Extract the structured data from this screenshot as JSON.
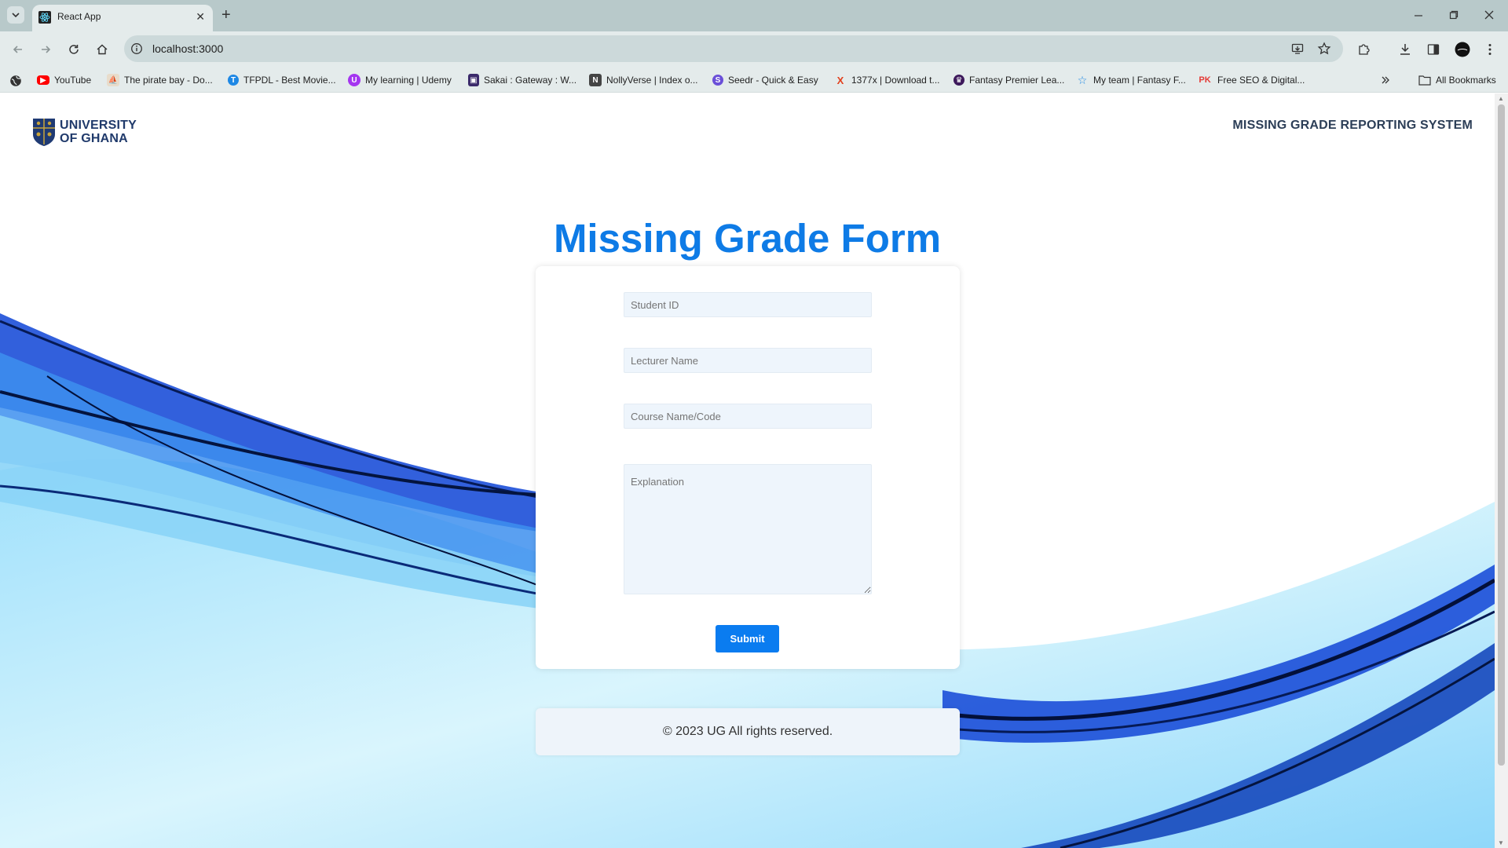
{
  "browser": {
    "tab_title": "React App",
    "tab_close_label": "✕",
    "url": "localhost:3000",
    "bookmarks": [
      {
        "label": "YouTube",
        "icon": "youtube-icon",
        "color": "#ff0000"
      },
      {
        "label": "The pirate bay - Do...",
        "icon": "pirate-ship-icon",
        "color": "#c79a64"
      },
      {
        "label": "TFPDL - Best Movie...",
        "icon": "tfpdl-icon",
        "color": "#1e88e5"
      },
      {
        "label": "My learning | Udemy",
        "icon": "udemy-icon",
        "color": "#a435f0"
      },
      {
        "label": "Sakai : Gateway : W...",
        "icon": "sakai-icon",
        "color": "#3b2a6b"
      },
      {
        "label": "NollyVerse | Index o...",
        "icon": "nollyverse-icon",
        "color": "#444444"
      },
      {
        "label": "Seedr - Quick & Easy",
        "icon": "seedr-icon",
        "color": "#6a4fd8"
      },
      {
        "label": "1377x | Download t...",
        "icon": "x-icon",
        "color": "#e2401c"
      },
      {
        "label": "Fantasy Premier Lea...",
        "icon": "premier-league-icon",
        "color": "#3d195b"
      },
      {
        "label": "My team | Fantasy F...",
        "icon": "star-icon",
        "color": "#1e88e5"
      },
      {
        "label": "Free SEO & Digital...",
        "icon": "pk-icon",
        "color": "#e53935"
      }
    ],
    "all_bookmarks_label": "All Bookmarks"
  },
  "header": {
    "logo_line1": "UNIVERSITY",
    "logo_line2": "OF GHANA",
    "site_title": "MISSING GRADE REPORTING SYSTEM"
  },
  "form": {
    "heading": "Missing Grade Form",
    "student_id_placeholder": "Student ID",
    "lecturer_name_placeholder": "Lecturer Name",
    "course_placeholder": "Course Name/Code",
    "explanation_placeholder": "Explanation",
    "submit_label": "Submit"
  },
  "footer": {
    "text": "© 2023 UG All rights reserved."
  },
  "colors": {
    "accent": "#0e7be6",
    "button": "#0a7cf0",
    "field_bg": "#eef5fc"
  }
}
